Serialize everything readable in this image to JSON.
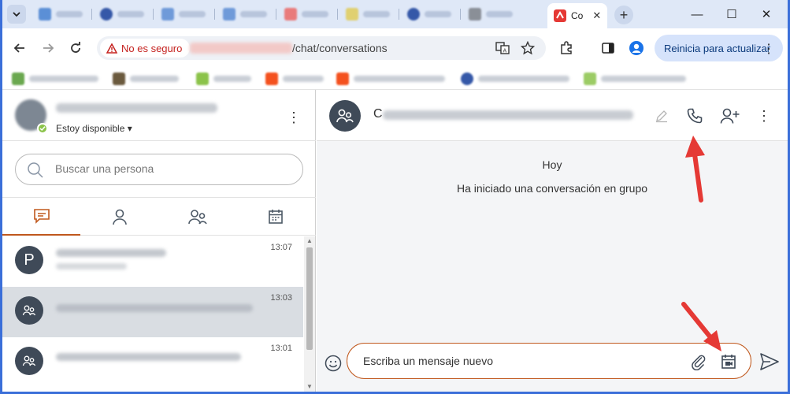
{
  "browser": {
    "active_tab_title": "Co",
    "active_tab_close": "✕",
    "new_tab": "+",
    "window_controls": {
      "minimize": "—",
      "maximize": "☐",
      "close": "✕"
    },
    "security_label": "No es seguro",
    "url_path": "/chat/conversations",
    "update_button": "Reinicia para actualizar",
    "update_menu": "⋮",
    "colors": {
      "tab_favicon": "#ef6c00",
      "accent": "#c0581d",
      "security": "#c5221f"
    }
  },
  "sidebar": {
    "profile_status": "Estoy disponible ▾",
    "search_placeholder": "Buscar una persona",
    "conversations": [
      {
        "avatar": "P",
        "time": "13:07"
      },
      {
        "avatar": "",
        "time": "13:03"
      },
      {
        "avatar": "",
        "time": "13:01"
      }
    ]
  },
  "chat": {
    "title_first_letter": "C",
    "day_label": "Hoy",
    "system_message": "Ha iniciado una conversación en grupo",
    "composer_placeholder": "Escriba un mensaje nuevo"
  }
}
